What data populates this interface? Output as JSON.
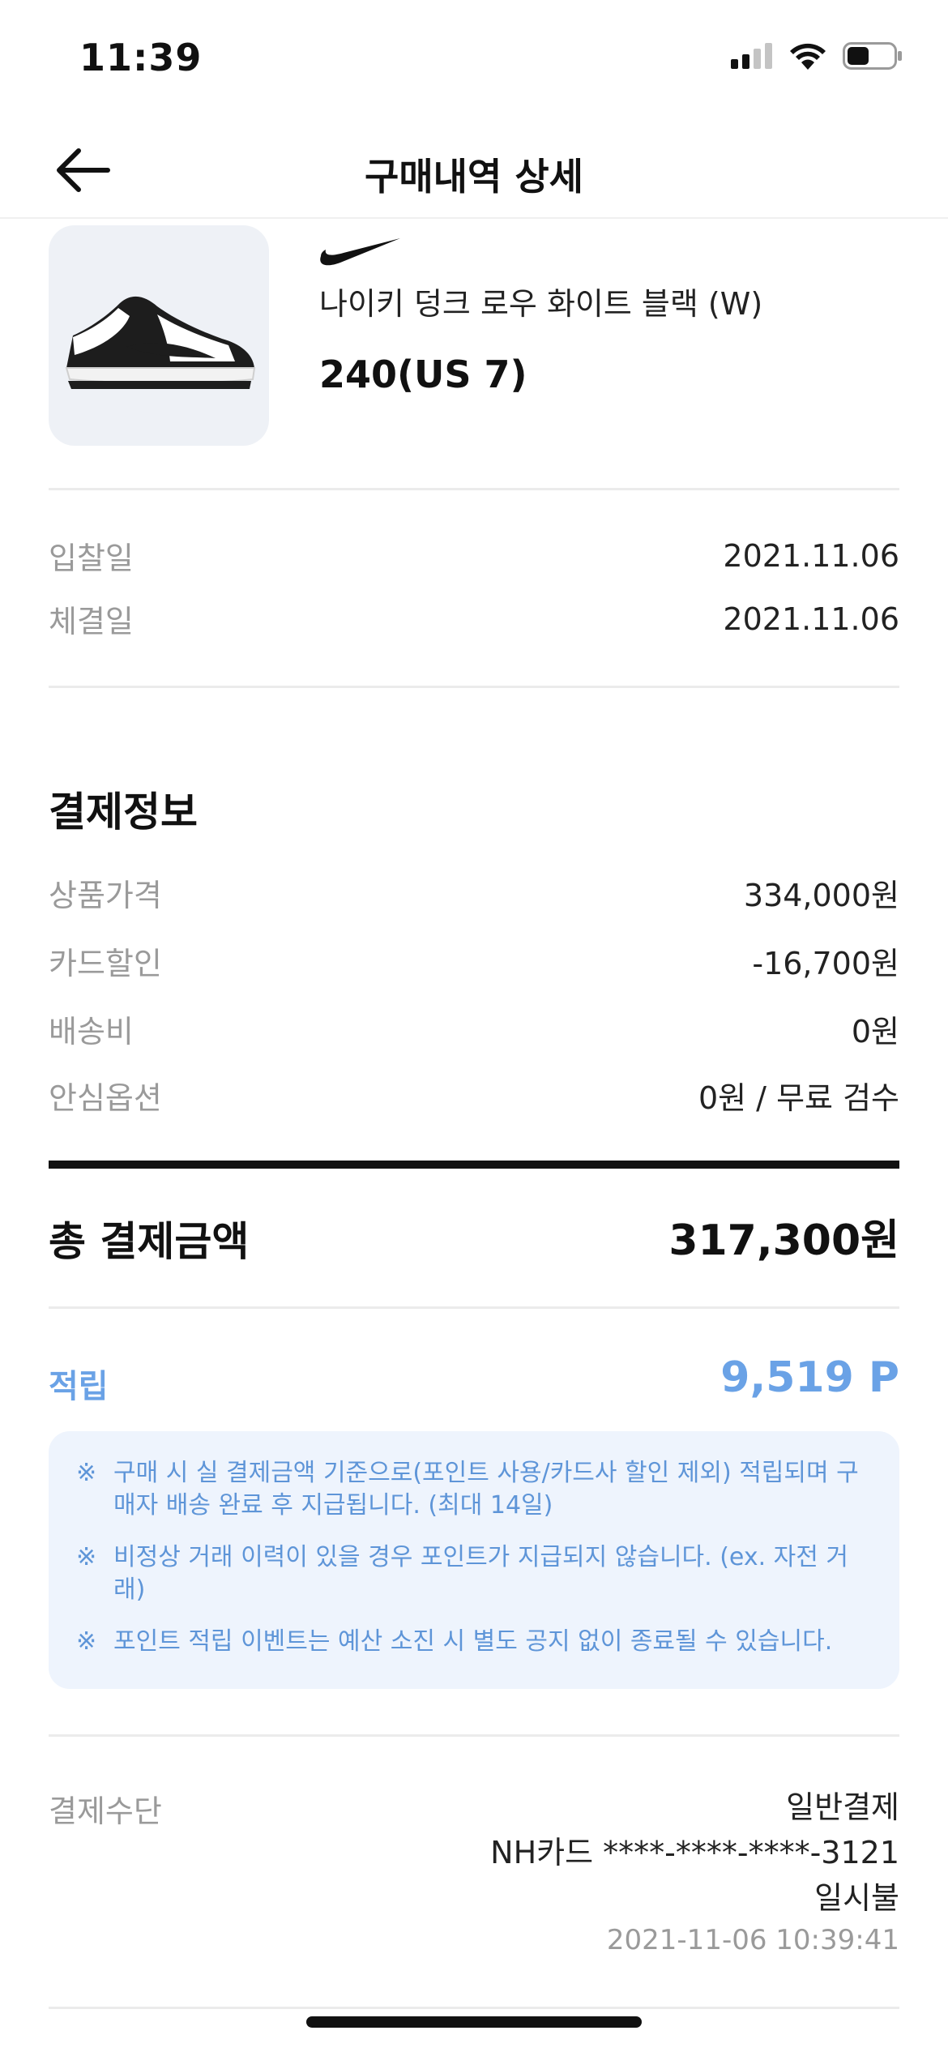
{
  "status_bar": {
    "time": "11:39"
  },
  "header": {
    "title": "구매내역 상세"
  },
  "product": {
    "brand_icon": "swoosh-icon",
    "name": "나이키 덩크 로우 화이트 블랙 (W)",
    "size": "240(US 7)"
  },
  "dates": [
    {
      "label": "입찰일",
      "value": "2021.11.06"
    },
    {
      "label": "체결일",
      "value": "2021.11.06"
    }
  ],
  "payment_info": {
    "title": "결제정보",
    "items": [
      {
        "label": "상품가격",
        "value": "334,000원"
      },
      {
        "label": "카드할인",
        "value": "-16,700원"
      },
      {
        "label": "배송비",
        "value": "0원"
      },
      {
        "label": "안심옵션",
        "value": "0원 / 무료 검수"
      }
    ],
    "total_label": "총 결제금액",
    "total_value": "317,300원"
  },
  "points": {
    "label": "적립",
    "value": "9,519 P",
    "notices": [
      {
        "mark": "※",
        "text": "구매 시 실 결제금액 기준으로(포인트 사용/카드사 할인 제외) 적립되며 구매자 배송 완료 후 지급됩니다. (최대 14일)"
      },
      {
        "mark": "※",
        "text": "비정상 거래 이력이 있을 경우 포인트가 지급되지 않습니다. (ex. 자전 거래)"
      },
      {
        "mark": "※",
        "text": "포인트 적립 이벤트는 예산 소진 시 별도 공지 없이 종료될 수 있습니다."
      }
    ]
  },
  "payment_method": {
    "label": "결제수단",
    "type": "일반결제",
    "card": "NH카드 ****-****-****-3121",
    "installment": "일시불",
    "datetime": "2021-11-06 10:39:41"
  },
  "colors": {
    "accent": "#6aa2e6",
    "notice_bg": "#eef4fd",
    "label_gray": "#9a9a9a"
  }
}
